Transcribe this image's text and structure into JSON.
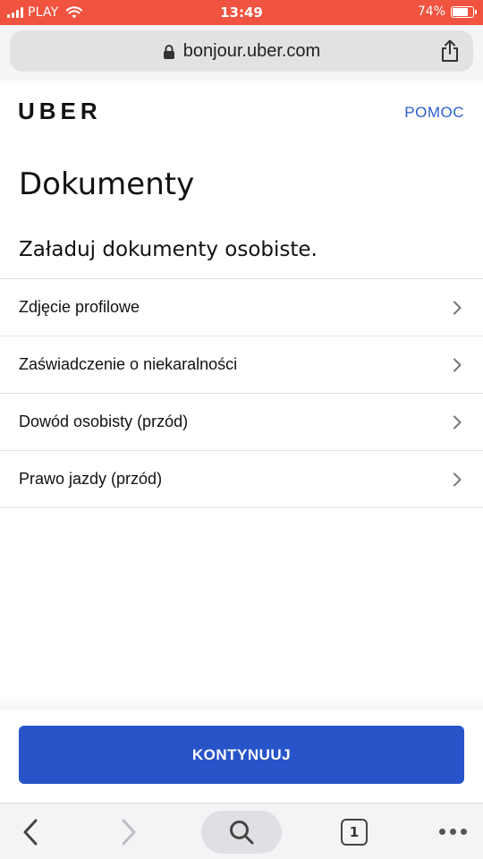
{
  "status_bar": {
    "carrier": "PLAY",
    "time": "13:49",
    "battery": "74%",
    "battery_level": 0.74,
    "bg_color": "#f0533f"
  },
  "browser": {
    "url": "bonjour.uber.com",
    "lock_icon": "lock-icon",
    "share_icon": "share-icon"
  },
  "header": {
    "logo": "UBER",
    "help_link": "POMOC"
  },
  "page": {
    "title": "Dokumenty",
    "subtitle": "Załaduj dokumenty osobiste."
  },
  "documents": [
    {
      "label": "Zdjęcie profilowe"
    },
    {
      "label": "Zaświadczenie o niekaralności"
    },
    {
      "label": "Dowód osobisty (przód)"
    },
    {
      "label": "Prawo jazdy (przód)"
    }
  ],
  "actions": {
    "continue_label": "KONTYNUUJ",
    "continue_color": "#2754c9"
  },
  "toolbar": {
    "tab_count": "1",
    "icons": [
      "back-icon",
      "forward-icon",
      "search-icon",
      "tabs-icon",
      "more-icon"
    ]
  }
}
